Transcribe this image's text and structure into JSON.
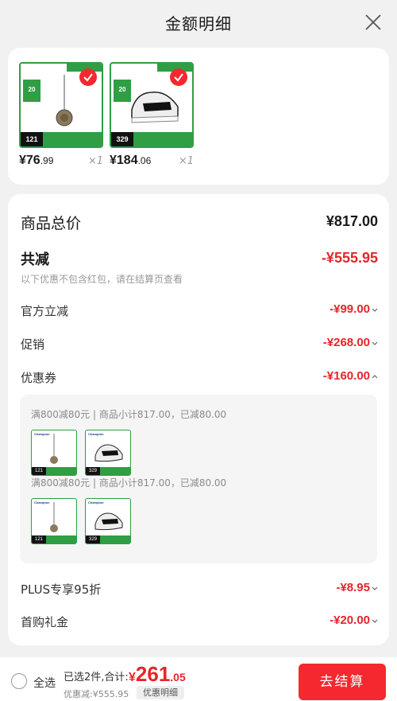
{
  "header": {
    "title": "金额明细"
  },
  "products": [
    {
      "price_main": "¥76",
      "price_dec": ".99",
      "qty": "×1",
      "tag": "121",
      "name": "pendant"
    },
    {
      "price_main": "¥184",
      "price_dec": ".06",
      "qty": "×1",
      "tag": "329",
      "name": "sneaker"
    }
  ],
  "summary": {
    "total_label": "商品总价",
    "total_value": "¥817.00",
    "reduction_label": "共减",
    "reduction_value": "-¥555.95",
    "note": "以下优惠不包含红包，请在结算页查看"
  },
  "discounts": [
    {
      "label": "官方立减",
      "value": "-¥99.00"
    },
    {
      "label": "促销",
      "value": "-¥268.00"
    },
    {
      "label": "优惠券",
      "value": "-¥160.00"
    },
    {
      "label": "PLUS专享95折",
      "value": "-¥8.95"
    },
    {
      "label": "首购礼金",
      "value": "-¥20.00"
    }
  ],
  "coupon_details": [
    {
      "text": "满800减80元 | 商品小计817.00，已减80.00"
    },
    {
      "text": "满800减80元 | 商品小计817.00，已减80.00"
    }
  ],
  "footer": {
    "select_all": "全选",
    "selected_info": "已选2件,合计:",
    "currency": "¥",
    "total_int": "261",
    "total_dec": ".05",
    "discount_info": "优惠减:¥555.95",
    "discount_detail": "优惠明细",
    "checkout": "去结算"
  },
  "colors": {
    "accent": "#f5282f",
    "discount_red": "#e4262a",
    "green": "#2f9e44"
  }
}
